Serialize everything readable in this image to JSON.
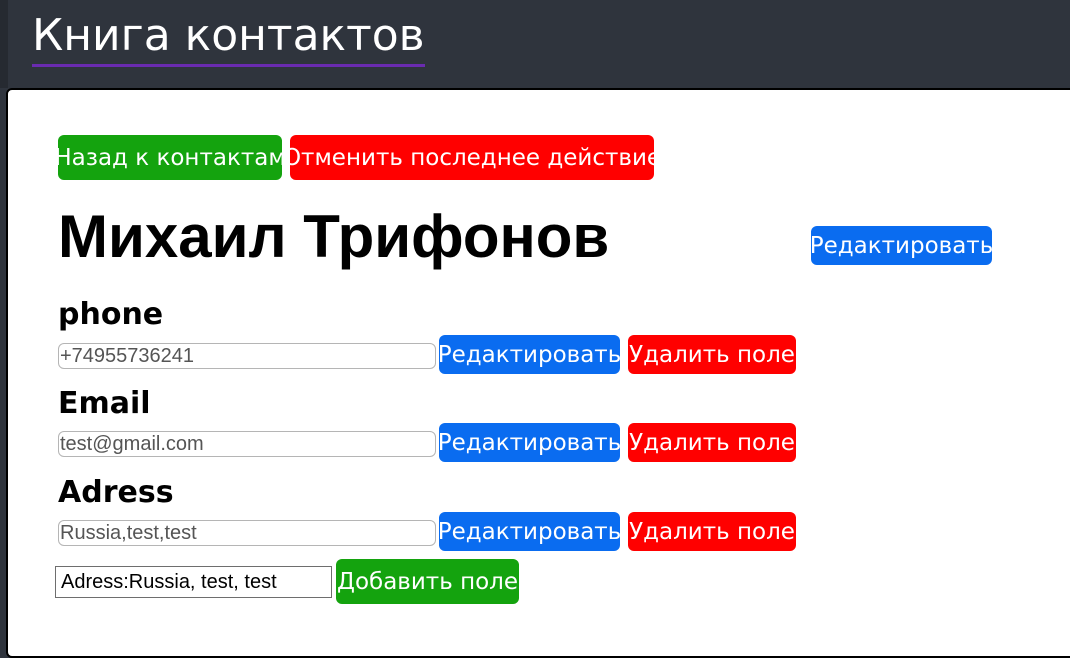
{
  "header": {
    "title": "Книга контактов"
  },
  "toolbar": {
    "back_label": "Назад к контактам",
    "undo_label": "Отменить последнее действие"
  },
  "contact": {
    "name": "Михаил Трифонов",
    "edit_label": "Редактировать"
  },
  "fields": [
    {
      "label": "phone",
      "value": "+74955736241",
      "edit_label": "Редактировать",
      "delete_label": "Удалить поле"
    },
    {
      "label": "Email",
      "value": "test@gmail.com",
      "edit_label": "Редактировать",
      "delete_label": "Удалить поле"
    },
    {
      "label": "Adress",
      "value": "Russia,test,test",
      "edit_label": "Редактировать",
      "delete_label": "Удалить поле"
    }
  ],
  "add_field": {
    "input_value": "Adress:Russia, test, test",
    "button_label": "Добавить поле"
  },
  "colors": {
    "green": "#14a30e",
    "red": "#ff0000",
    "blue": "#0a6cf0",
    "header_bg": "#2f343d"
  }
}
